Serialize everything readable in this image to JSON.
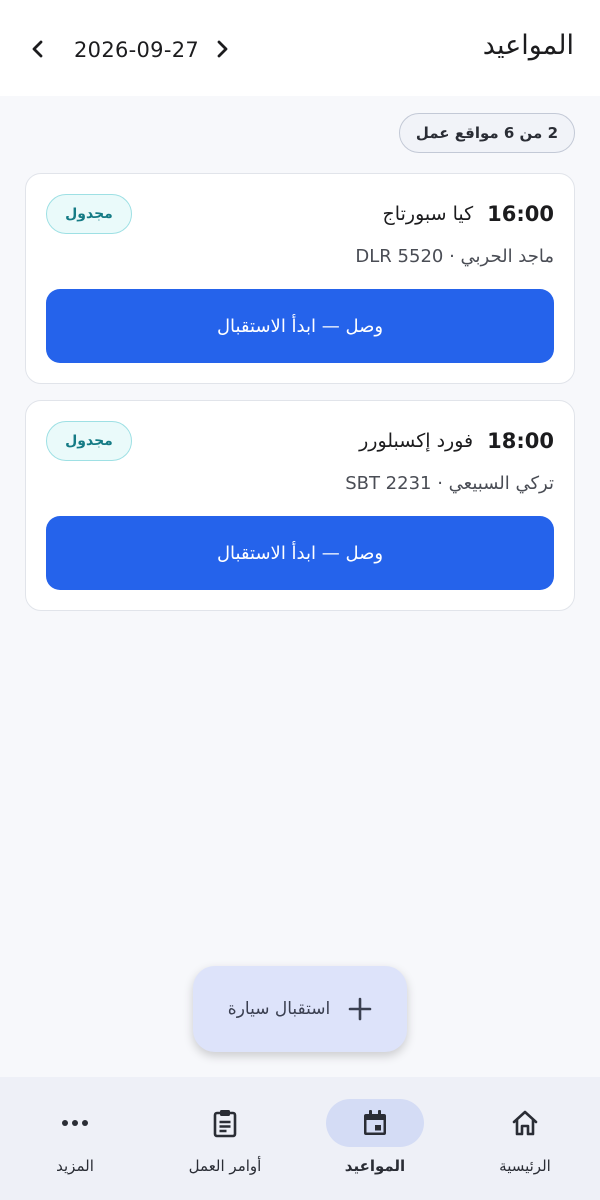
{
  "header": {
    "title": "المواعيد",
    "date": "2026-09-27"
  },
  "summary": {
    "count_label": "2 من 6 مواقع عمل"
  },
  "appointments": [
    {
      "time": "16:00",
      "vehicle": "كيا سبورتاج",
      "customer_plate": "ماجد الحربي · DLR 5520",
      "status": "مجدول",
      "action_label": "وصل — ابدأ الاستقبال"
    },
    {
      "time": "18:00",
      "vehicle": "فورد إكسبلورر",
      "customer_plate": "تركي السبيعي · SBT 2231",
      "status": "مجدول",
      "action_label": "وصل — ابدأ الاستقبال"
    }
  ],
  "fab": {
    "label": "استقبال سيارة",
    "icon": "plus-icon"
  },
  "bottom_nav": {
    "items": [
      {
        "label": "الرئيسية",
        "icon": "home-icon"
      },
      {
        "label": "المواعيد",
        "icon": "calendar-icon",
        "active": true
      },
      {
        "label": "أوامر العمل",
        "icon": "clipboard-icon"
      },
      {
        "label": "المزيد",
        "icon": "more-dots-icon"
      }
    ]
  },
  "colors": {
    "primary": "#2563eb",
    "badge_text": "#157b85",
    "fab_bg": "#dde3fa",
    "nav_active_bg": "#d4dcf5"
  }
}
